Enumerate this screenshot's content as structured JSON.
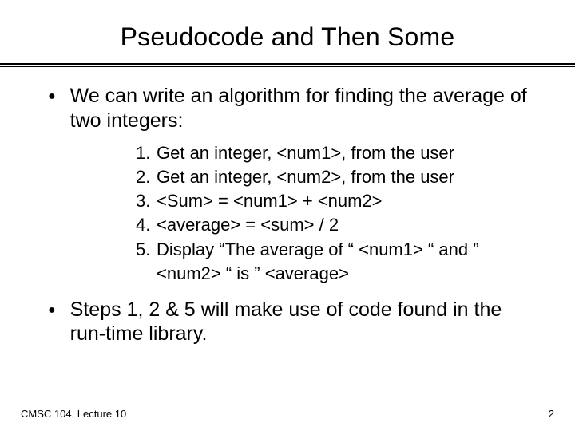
{
  "title": "Pseudocode and Then Some",
  "bullets": {
    "b1": "We can write an algorithm for finding the average of two integers:",
    "b2": "Steps 1, 2 & 5 will make use of code found in the run-time library."
  },
  "steps": {
    "n1": "1.",
    "s1": "Get an integer, <num1>, from the user",
    "n2": "2.",
    "s2": "Get an integer, <num2>, from the user",
    "n3": "3.",
    "s3": "<Sum> = <num1> + <num2>",
    "n4": "4.",
    "s4": "<average> = <sum> / 2",
    "n5": "5.",
    "s5a": "Display “The average of “ <num1> “ and ”",
    "s5b": "<num2> “ is ” <average>"
  },
  "footer": {
    "left": "CMSC 104, Lecture 10",
    "right": "2"
  }
}
